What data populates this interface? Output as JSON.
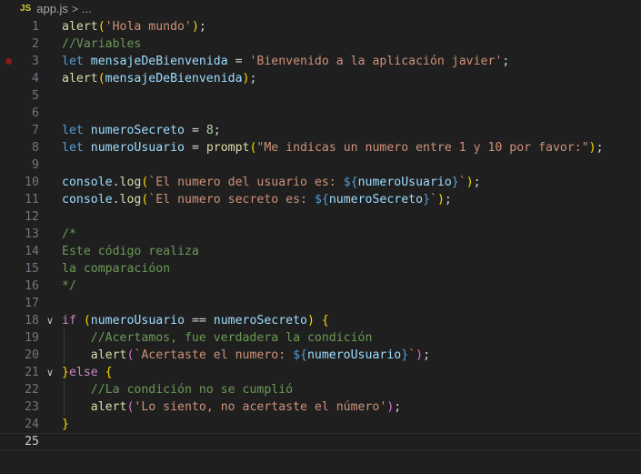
{
  "breadcrumb": {
    "badge": "JS",
    "file": "app.js",
    "separator": ">",
    "more": "..."
  },
  "editor": {
    "current_line": 25,
    "breakpoint_line": 3,
    "fold_lines": [
      18,
      21
    ],
    "lines": [
      {
        "n": "1",
        "tokens": [
          [
            "t-fn",
            "alert"
          ],
          [
            "t-br1",
            "("
          ],
          [
            "t-str",
            "'Hola mundo'"
          ],
          [
            "t-br1",
            ")"
          ],
          [
            "t-pun",
            ";"
          ]
        ]
      },
      {
        "n": "2",
        "tokens": [
          [
            "t-cm",
            "//Variables"
          ]
        ]
      },
      {
        "n": "3",
        "tokens": [
          [
            "t-kw",
            "let"
          ],
          [
            "t-pun",
            " "
          ],
          [
            "t-var",
            "mensajeDeBienvenida"
          ],
          [
            "t-pun",
            " = "
          ],
          [
            "t-str",
            "'Bienvenido a la aplicación javier'"
          ],
          [
            "t-pun",
            ";"
          ]
        ]
      },
      {
        "n": "4",
        "tokens": [
          [
            "t-fn",
            "alert"
          ],
          [
            "t-br1",
            "("
          ],
          [
            "t-var",
            "mensajeDeBienvenida"
          ],
          [
            "t-br1",
            ")"
          ],
          [
            "t-pun",
            ";"
          ]
        ]
      },
      {
        "n": "5",
        "tokens": []
      },
      {
        "n": "6",
        "tokens": []
      },
      {
        "n": "7",
        "tokens": [
          [
            "t-kw",
            "let"
          ],
          [
            "t-pun",
            " "
          ],
          [
            "t-var",
            "numeroSecreto"
          ],
          [
            "t-pun",
            " = "
          ],
          [
            "t-num",
            "8"
          ],
          [
            "t-pun",
            ";"
          ]
        ]
      },
      {
        "n": "8",
        "tokens": [
          [
            "t-kw",
            "let"
          ],
          [
            "t-pun",
            " "
          ],
          [
            "t-var",
            "numeroUsuario"
          ],
          [
            "t-pun",
            " = "
          ],
          [
            "t-fn",
            "prompt"
          ],
          [
            "t-br1",
            "("
          ],
          [
            "t-str",
            "\"Me indicas un numero entre 1 y 10 por favor:\""
          ],
          [
            "t-br1",
            ")"
          ],
          [
            "t-pun",
            ";"
          ]
        ]
      },
      {
        "n": "9",
        "tokens": []
      },
      {
        "n": "10",
        "tokens": [
          [
            "t-var",
            "console"
          ],
          [
            "t-pun",
            "."
          ],
          [
            "t-fn",
            "log"
          ],
          [
            "t-br1",
            "("
          ],
          [
            "t-str",
            "`El numero del usuario es: "
          ],
          [
            "t-kw",
            "${"
          ],
          [
            "t-var",
            "numeroUsuario"
          ],
          [
            "t-kw",
            "}"
          ],
          [
            "t-str",
            "`"
          ],
          [
            "t-br1",
            ")"
          ],
          [
            "t-pun",
            ";"
          ]
        ]
      },
      {
        "n": "11",
        "tokens": [
          [
            "t-var",
            "console"
          ],
          [
            "t-pun",
            "."
          ],
          [
            "t-fn",
            "log"
          ],
          [
            "t-br1",
            "("
          ],
          [
            "t-str",
            "`El numero secreto es: "
          ],
          [
            "t-kw",
            "${"
          ],
          [
            "t-var",
            "numeroSecreto"
          ],
          [
            "t-kw",
            "}"
          ],
          [
            "t-str",
            "`"
          ],
          [
            "t-br1",
            ")"
          ],
          [
            "t-pun",
            ";"
          ]
        ]
      },
      {
        "n": "12",
        "tokens": []
      },
      {
        "n": "13",
        "tokens": [
          [
            "t-cm",
            "/*"
          ]
        ]
      },
      {
        "n": "14",
        "tokens": [
          [
            "t-cm",
            "Este código realiza"
          ]
        ]
      },
      {
        "n": "15",
        "tokens": [
          [
            "t-cm",
            "la comparacióon"
          ]
        ]
      },
      {
        "n": "16",
        "tokens": [
          [
            "t-cm",
            "*/"
          ]
        ]
      },
      {
        "n": "17",
        "tokens": []
      },
      {
        "n": "18",
        "tokens": [
          [
            "t-ctl",
            "if"
          ],
          [
            "t-pun",
            " "
          ],
          [
            "t-br1",
            "("
          ],
          [
            "t-var",
            "numeroUsuario"
          ],
          [
            "t-pun",
            " == "
          ],
          [
            "t-var",
            "numeroSecreto"
          ],
          [
            "t-br1",
            ")"
          ],
          [
            "t-pun",
            " "
          ],
          [
            "t-br1",
            "{"
          ]
        ]
      },
      {
        "n": "19",
        "tokens": [
          [
            "t-pun",
            "    "
          ],
          [
            "t-cm",
            "//Acertamos, fue verdadera la condición"
          ]
        ]
      },
      {
        "n": "20",
        "tokens": [
          [
            "t-pun",
            "    "
          ],
          [
            "t-fn",
            "alert"
          ],
          [
            "t-br2",
            "("
          ],
          [
            "t-str",
            "`Acertaste el numero: "
          ],
          [
            "t-kw",
            "${"
          ],
          [
            "t-var",
            "numeroUsuario"
          ],
          [
            "t-kw",
            "}"
          ],
          [
            "t-str",
            "`"
          ],
          [
            "t-br2",
            ")"
          ],
          [
            "t-pun",
            ";"
          ]
        ]
      },
      {
        "n": "21",
        "tokens": [
          [
            "t-br1",
            "}"
          ],
          [
            "t-ctl",
            "else"
          ],
          [
            "t-pun",
            " "
          ],
          [
            "t-br1",
            "{"
          ]
        ]
      },
      {
        "n": "22",
        "tokens": [
          [
            "t-pun",
            "    "
          ],
          [
            "t-cm",
            "//La condición no se cumplió"
          ]
        ]
      },
      {
        "n": "23",
        "tokens": [
          [
            "t-pun",
            "    "
          ],
          [
            "t-fn",
            "alert"
          ],
          [
            "t-br2",
            "("
          ],
          [
            "t-str",
            "'Lo siento, no acertaste el número'"
          ],
          [
            "t-br2",
            ")"
          ],
          [
            "t-pun",
            ";"
          ]
        ]
      },
      {
        "n": "24",
        "tokens": [
          [
            "t-br1",
            "}"
          ]
        ]
      },
      {
        "n": "25",
        "tokens": []
      }
    ]
  }
}
